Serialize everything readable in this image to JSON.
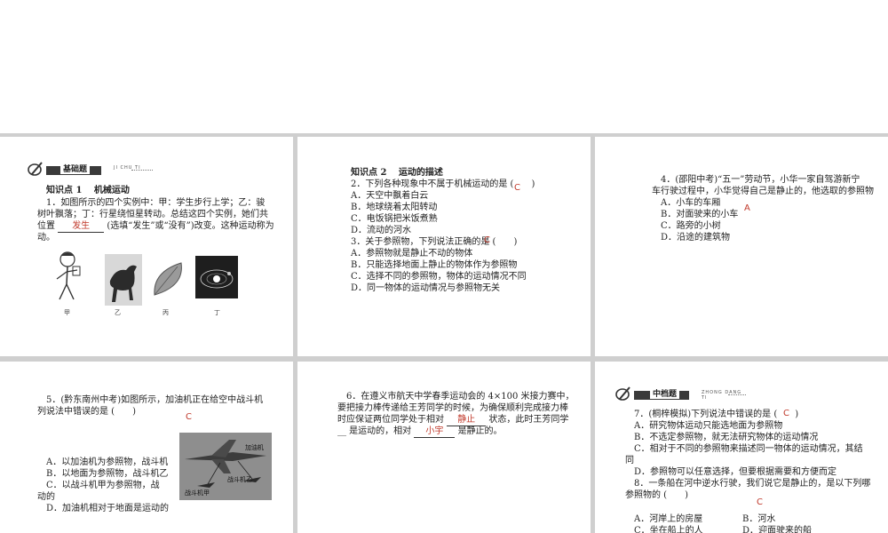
{
  "section_basic": {
    "title": "基础题",
    "pinyin": "JI CHU TI"
  },
  "section_mid": {
    "title": "中档题",
    "pinyin": "ZHONG DANG TI"
  },
  "kp1": {
    "heading": "知识点 1　 机械运动",
    "q1_line1": "1．如图所示的四个实例中：甲：学生步行上学；乙：骏",
    "q1_line2": "树叶飘落；丁：行星绕恒星转动。总结这四个实例，她们共",
    "q1_line3a": "位置",
    "q1_answer": "发生",
    "q1_line3b": "(选填“发生”或“没有”)改变。这种运动称为",
    "q1_line4": "动。",
    "captions": [
      "甲",
      "乙",
      "丙",
      "丁"
    ]
  },
  "kp2": {
    "heading": "知识点 2　 运动的描述",
    "q2_stem": "2．下列各种现象中不属于机械运动的是 (　　)",
    "q2_answer": "C",
    "q2_options": [
      "A．天空中飘着白云",
      "B．地球绕着太阳转动",
      "C．电饭锅把米饭煮熟",
      "D．流动的河水"
    ],
    "q3_stem": "3．关于参照物，下列说法正确的是 (　　)",
    "q3_answer": "C",
    "q3_options": [
      "A．参照物就是静止不动的物体",
      "B．只能选择地面上静止的物体作为参照物",
      "C．选择不同的参照物，物体的运动情况不同",
      "D．同一物体的运动情况与参照物无关"
    ]
  },
  "q4": {
    "line1": "4．(邵阳中考)“五一”劳动节，小华一家自驾游新宁",
    "line2": "车行驶过程中，小华觉得自己是静止的，他选取的参照物",
    "answer": "A",
    "options": [
      "A．小车的车厢",
      "B．对面驶来的小车",
      "C．路旁的小树",
      "D．沿途的建筑物"
    ]
  },
  "q5": {
    "line1": "5．(黔东南州中考)如图所示，加油机正在给空中战斗机",
    "line2": "列说法中错误的是 (　　)",
    "answer": "C",
    "options": [
      "A．以加油机为参照物，战斗机",
      "B．以地面为参照物，战斗机乙",
      "C．以战斗机甲为参照物，战",
      "动的",
      "D．加油机相对于地面是运动的"
    ],
    "fig_labels": [
      "加油机",
      "战斗机乙",
      "战斗机甲"
    ]
  },
  "q6": {
    "line1": "6．在遵义市航天中学春季运动会的 4×100 米接力赛中，",
    "line2": "要把接力棒传递给王芳同学的时候，为确保顺利完成接力棒",
    "line3a": "时应保证两位同学处于相对",
    "answer1": "静止",
    "line3b": "状态，此时王芳同学",
    "line4a": "__ 是运动的，相对",
    "answer2": "小宇",
    "line4b": "是静止的。"
  },
  "q7": {
    "stem": "7．(桐梓模拟)下列说法中错误的是 (　　)",
    "answer": "C",
    "options": [
      "A．研究物体运动只能选地面为参照物",
      "B．不选定参照物，就无法研究物体的运动情况",
      "C．相对于不同的参照物来描述同一物体的运动情况，其结",
      "同",
      "D．参照物可以任意选择，但要根据需要和方便而定"
    ]
  },
  "q8": {
    "line1": "8．一条船在河中逆水行驶，我们说它是静止的，是以下列哪",
    "line2": "参照物的 (　　)",
    "answer": "C",
    "options": [
      "A．河岸上的房屋",
      "B．河水",
      "C．坐在船上的人",
      "D．迎面驶来的船"
    ]
  },
  "colors": {
    "answer": "#c0392b",
    "divider": "#cfcfcf"
  }
}
